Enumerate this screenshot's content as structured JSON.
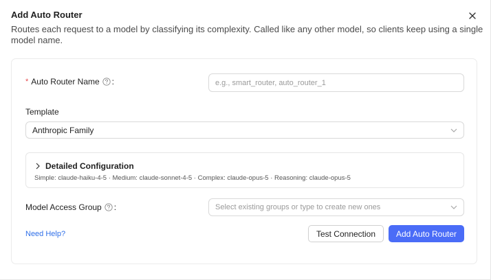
{
  "modal": {
    "title": "Add Auto Router",
    "description": "Routes each request to a model by classifying its complexity. Called like any other model, so clients keep using a single model name."
  },
  "form": {
    "router_name": {
      "required_mark": "*",
      "label": "Auto Router Name",
      "colon": ":",
      "placeholder": "e.g., smart_router, auto_router_1"
    },
    "template": {
      "label": "Template",
      "value": "Anthropic Family"
    },
    "detailed_config": {
      "title": "Detailed Configuration",
      "summary": "Simple: claude-haiku-4-5 · Medium: claude-sonnet-4-5 · Complex: claude-opus-5 · Reasoning: claude-opus-5"
    },
    "access_group": {
      "label": "Model Access Group",
      "colon": ":",
      "placeholder": "Select existing groups or type to create new ones"
    }
  },
  "footer": {
    "help_link": "Need Help?",
    "test_button": "Test Connection",
    "submit_button": "Add Auto Router"
  },
  "icons": {
    "close": "close-icon",
    "help": "question-circle-icon",
    "chevron_down": "chevron-down-icon",
    "chevron_right": "chevron-right-icon"
  },
  "colors": {
    "primary": "#4a6cf7",
    "link": "#2f6fe8",
    "required": "#e5484d"
  }
}
